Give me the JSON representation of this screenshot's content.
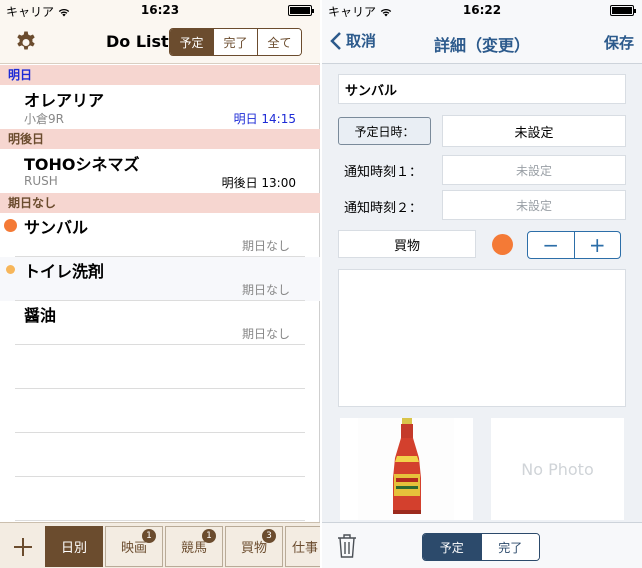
{
  "left": {
    "status": {
      "carrier": "キャリア",
      "time": "16:23"
    },
    "nav": {
      "title": "Do List",
      "segments": [
        "予定",
        "完了",
        "全て"
      ]
    },
    "sections": [
      {
        "header": "明日",
        "items": [
          {
            "name": "オレアリア",
            "sub": "小倉9R",
            "due": "明日 14:15"
          }
        ]
      },
      {
        "header": "明後日",
        "items": [
          {
            "name": "TOHOシネマズ",
            "sub": "RUSH",
            "due": "明後日 13:00"
          }
        ]
      },
      {
        "header": "期日なし",
        "items": [
          {
            "name": "サンバル",
            "due": "期日なし",
            "dot": "#f47a36"
          },
          {
            "name": "トイレ洗剤",
            "due": "期日なし",
            "dot": "#f7b65a"
          },
          {
            "name": "醤油",
            "due": "期日なし"
          }
        ]
      }
    ],
    "tabbar": {
      "tabs": [
        {
          "label": "日別",
          "badge": ""
        },
        {
          "label": "映画",
          "badge": "1"
        },
        {
          "label": "競馬",
          "badge": "1"
        },
        {
          "label": "買物",
          "badge": "3"
        },
        {
          "label": "仕事",
          "badge": ""
        }
      ]
    }
  },
  "right": {
    "status": {
      "carrier": "キャリア",
      "time": "16:22"
    },
    "nav": {
      "back": "取消",
      "title": "詳細（変更）",
      "save": "保存"
    },
    "name_value": "サンバル",
    "schedule_button": "予定日時：",
    "schedule_value": "未設定",
    "notify1_label": "通知時刻１：",
    "notify1_value": "未設定",
    "notify2_label": "通知時刻２：",
    "notify2_value": "未設定",
    "category": "買物",
    "color": "#f47a36",
    "stepper": {
      "minus": "−",
      "plus": "+"
    },
    "memo": "",
    "no_photo": "No Photo",
    "segments": [
      "予定",
      "完了"
    ]
  },
  "colors": {
    "accent_brown": "#6b4c2e",
    "accent_blue": "#2c5a8c",
    "section_bg": "#f6d6d0"
  }
}
